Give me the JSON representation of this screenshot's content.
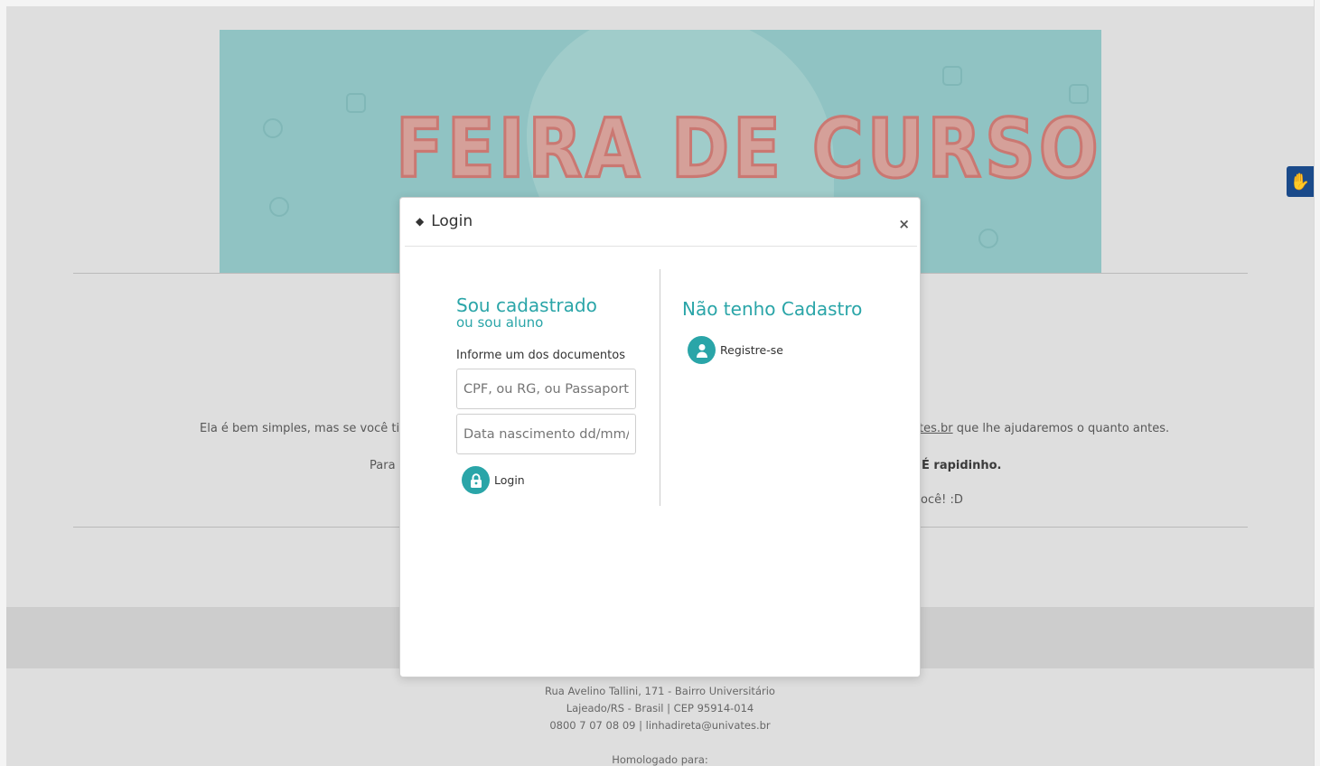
{
  "banner": {
    "title": "FEIRA DE CURSOS"
  },
  "info": {
    "line1_left": "Ela é bem simples, mas se você tiv",
    "line1_right_link": "tes.br",
    "line1_right_rest": " que lhe ajudaremos o quanto antes.",
    "line2_left": "Para",
    "line2_right": "É rapidinho.",
    "line3_right": "ocê! :D"
  },
  "footer": {
    "address": "Rua Avelino Tallini, 171 - Bairro Universitário",
    "city": "Lajeado/RS - Brasil | CEP 95914-014",
    "contact": "0800 7 07 08 09 | linhadireta@univates.br",
    "homologado": "Homologado para:"
  },
  "modal": {
    "title": "Login",
    "close": "×",
    "left": {
      "heading": "Sou cadastrado",
      "subheading": "ou sou aluno",
      "doc_label": "Informe um dos documentos",
      "doc_placeholder": "CPF, ou RG, ou Passaporte",
      "birth_placeholder": "Data nascimento dd/mm/aaaa",
      "login_label": "Login"
    },
    "right": {
      "heading": "Não tenho Cadastro",
      "register_label": "Registre-se"
    }
  },
  "icons": {
    "sort": "sort-icon",
    "close": "close-icon",
    "lock": "lock-icon",
    "user": "user-icon",
    "accessibility": "sign-language-icon"
  },
  "colors": {
    "accent": "#2aa5a8",
    "banner": "#a6e0e0",
    "a11y": "#1a4a8a"
  }
}
